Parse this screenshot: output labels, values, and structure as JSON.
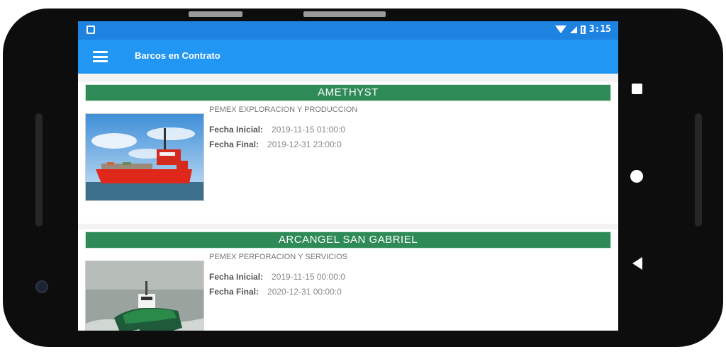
{
  "status_bar": {
    "time": "3:15"
  },
  "app_bar": {
    "title": "Barcos en Contrato"
  },
  "labels": {
    "fecha_inicial": "Fecha Inicial:",
    "fecha_final": "Fecha Final:"
  },
  "vessels": [
    {
      "name": "AMETHYST",
      "company": "PEMEX EXPLORACION Y PRODUCCION",
      "fecha_inicial": "2019-11-15 01:00:0",
      "fecha_final": "2019-12-31 23:00:0"
    },
    {
      "name": "ARCANGEL SAN GABRIEL",
      "company": "PEMEX PERFORACION Y SERVICIOS",
      "fecha_inicial": "2019-11-15 00:00:0",
      "fecha_final": "2020-12-31 00:00:0"
    }
  ],
  "colors": {
    "status_bar": "#1e82e0",
    "app_bar": "#2196f3",
    "vessel_header": "#2e8b57"
  },
  "icons": [
    "menu-icon",
    "wifi-icon",
    "signal-icon",
    "battery-icon",
    "nav-recents-icon",
    "nav-home-icon",
    "nav-back-icon"
  ]
}
